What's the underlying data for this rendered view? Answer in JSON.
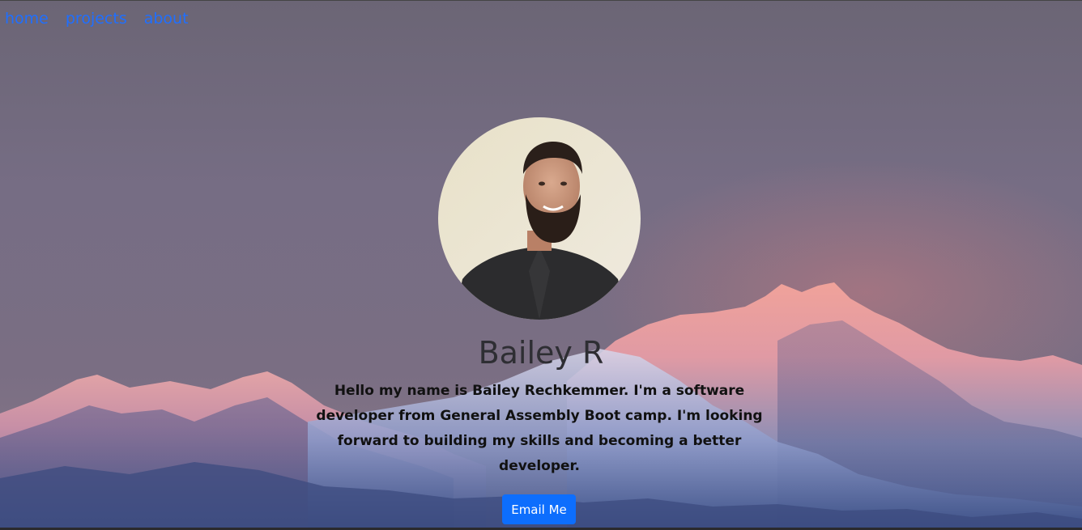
{
  "nav": {
    "items": [
      {
        "label": "home"
      },
      {
        "label": "projects"
      },
      {
        "label": "about"
      }
    ],
    "link_color": "#1f6fff"
  },
  "profile": {
    "name": "Bailey R",
    "bio": "Hello my name is Bailey Rechkemmer. I'm a software developer from General Assembly Boot camp. I'm looking forward to building my skills and becoming a better developer.",
    "email_button_label": "Email Me"
  },
  "colors": {
    "sky": "#6e6780",
    "button": "#0d6efd",
    "mountain_glow": "#e88a86"
  },
  "background": {
    "icon": "mountain-landscape-image"
  }
}
